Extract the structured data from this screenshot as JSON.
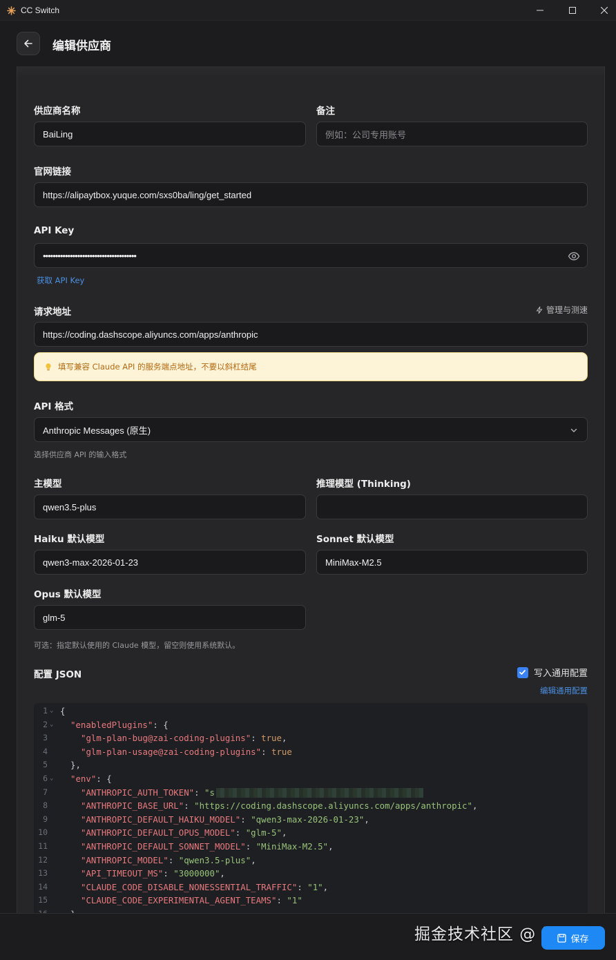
{
  "window": {
    "title": "CC Switch"
  },
  "header": {
    "title": "编辑供应商"
  },
  "form": {
    "provider_name_label": "供应商名称",
    "provider_name_value": "BaiLing",
    "note_label": "备注",
    "note_placeholder": "例如：公司专用账号",
    "website_label": "官网链接",
    "website_value": "https://alipaytbox.yuque.com/sxs0ba/ling/get_started",
    "api_key_label": "API Key",
    "api_key_value": "••••••••••••••••••••••••••••••••••••••",
    "get_api_key_link": "获取 API Key",
    "endpoint_label": "请求地址",
    "manage_label": "管理与测速",
    "endpoint_value": "https://coding.dashscope.aliyuncs.com/apps/anthropic",
    "endpoint_warning": "填写兼容 Claude API 的服务端点地址，不要以斜杠结尾",
    "api_format_label": "API 格式",
    "api_format_value": "Anthropic Messages (原生)",
    "api_format_hint": "选择供应商 API 的输入格式",
    "main_model_label": "主模型",
    "main_model_value": "qwen3.5-plus",
    "thinking_model_label": "推理模型 (Thinking)",
    "thinking_model_value": "",
    "haiku_label": "Haiku 默认模型",
    "haiku_value": "qwen3-max-2026-01-23",
    "sonnet_label": "Sonnet 默认模型",
    "sonnet_value": "MiniMax-M2.5",
    "opus_label": "Opus 默认模型",
    "opus_value": "glm-5",
    "models_hint": "可选：指定默认使用的 Claude 模型，留空则使用系统默认。",
    "config_json_label": "配置 JSON",
    "write_common_label": "写入通用配置",
    "write_common_checked": true,
    "edit_common_link": "编辑通用配置"
  },
  "editor": {
    "lines": [
      {
        "n": "1",
        "fold": true,
        "text": "{"
      },
      {
        "n": "2",
        "fold": true,
        "key": "\"enabledPlugins\"",
        "rest": ": {"
      },
      {
        "n": "3",
        "fold": false,
        "key": "\"glm-plan-bug@zai-coding-plugins\"",
        "rest": ": ",
        "bool": "true",
        "tail": ","
      },
      {
        "n": "4",
        "fold": false,
        "key": "\"glm-plan-usage@zai-coding-plugins\"",
        "rest": ": ",
        "bool": "true",
        "tail": ""
      },
      {
        "n": "5",
        "fold": false,
        "text": "},"
      },
      {
        "n": "6",
        "fold": true,
        "key": "\"env\"",
        "rest": ": {"
      },
      {
        "n": "7",
        "fold": false,
        "key": "\"ANTHROPIC_AUTH_TOKEN\"",
        "rest": ": ",
        "str": "\"s",
        "redacted": true
      },
      {
        "n": "8",
        "fold": false,
        "key": "\"ANTHROPIC_BASE_URL\"",
        "rest": ": ",
        "str": "\"https://coding.dashscope.aliyuncs.com/apps/anthropic\"",
        "tail": ","
      },
      {
        "n": "9",
        "fold": false,
        "key": "\"ANTHROPIC_DEFAULT_HAIKU_MODEL\"",
        "rest": ": ",
        "str": "\"qwen3-max-2026-01-23\"",
        "tail": ","
      },
      {
        "n": "10",
        "fold": false,
        "key": "\"ANTHROPIC_DEFAULT_OPUS_MODEL\"",
        "rest": ": ",
        "str": "\"glm-5\"",
        "tail": ","
      },
      {
        "n": "11",
        "fold": false,
        "key": "\"ANTHROPIC_DEFAULT_SONNET_MODEL\"",
        "rest": ": ",
        "str": "\"MiniMax-M2.5\"",
        "tail": ","
      },
      {
        "n": "12",
        "fold": false,
        "key": "\"ANTHROPIC_MODEL\"",
        "rest": ": ",
        "str": "\"qwen3.5-plus\"",
        "tail": ","
      },
      {
        "n": "13",
        "fold": false,
        "key": "\"API_TIMEOUT_MS\"",
        "rest": ": ",
        "str": "\"3000000\"",
        "tail": ","
      },
      {
        "n": "14",
        "fold": false,
        "key": "\"CLAUDE_CODE_DISABLE_NONESSENTIAL_TRAFFIC\"",
        "rest": ": ",
        "str": "\"1\"",
        "tail": ","
      },
      {
        "n": "15",
        "fold": false,
        "key": "\"CLAUDE_CODE_EXPERIMENTAL_AGENT_TEAMS\"",
        "rest": ": ",
        "str": "\"1\"",
        "tail": ""
      },
      {
        "n": "16",
        "fold": false,
        "text": "},"
      }
    ]
  },
  "footer": {
    "save_label": "保存",
    "watermark": "掘金技术社区 @ 词元派"
  },
  "colors": {
    "accent": "#1e88f5",
    "link": "#4a90e2",
    "warning_bg": "#fdf3d6",
    "warning_text": "#b26a12"
  }
}
